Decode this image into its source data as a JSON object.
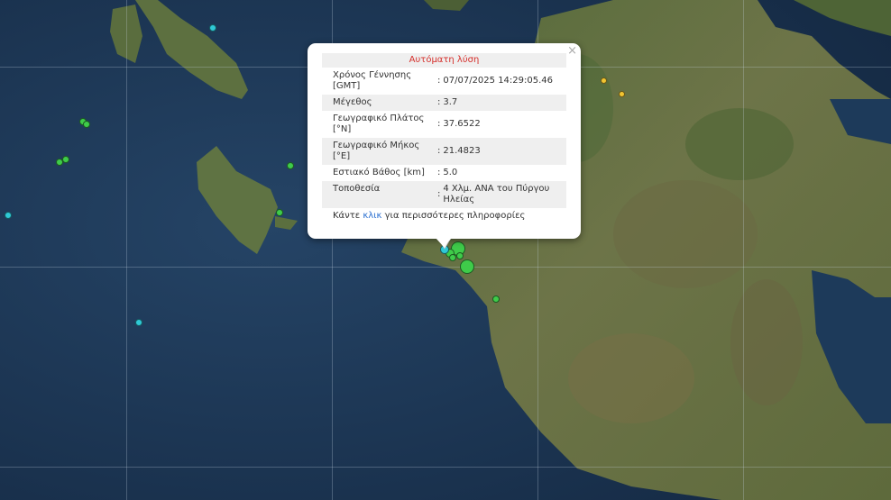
{
  "popup": {
    "title": "Αυτόματη λύση",
    "close_icon": "×",
    "rows": [
      {
        "label": "Χρόνος Γέννησης [GMT]",
        "value": "07/07/2025 14:29:05.46"
      },
      {
        "label": "Μέγεθος",
        "value": "3.7"
      },
      {
        "label": "Γεωγραφικό Πλάτος [°N]",
        "value": "37.6522"
      },
      {
        "label": "Γεωγραφικό Μήκος [°E]",
        "value": "21.4823"
      },
      {
        "label": "Εστιακό Βάθος [km]",
        "value": "5.0"
      },
      {
        "label": "Τοποθεσία",
        "value": "4 Χλμ. ΑΝΑ του Πύργου Ηλείας"
      }
    ],
    "more_prefix": "Κάντε",
    "more_link": "κλικ",
    "more_suffix": "για περισσότερες πληροφορίες",
    "title_color": "#d6302c",
    "link_color": "#2a6fd0"
  },
  "markers": {
    "colors": {
      "recent": "#3fcb4a",
      "cyan": "#2fc9d6",
      "yellow": "#f2c531"
    },
    "icon": "earthquake-marker-icon"
  }
}
